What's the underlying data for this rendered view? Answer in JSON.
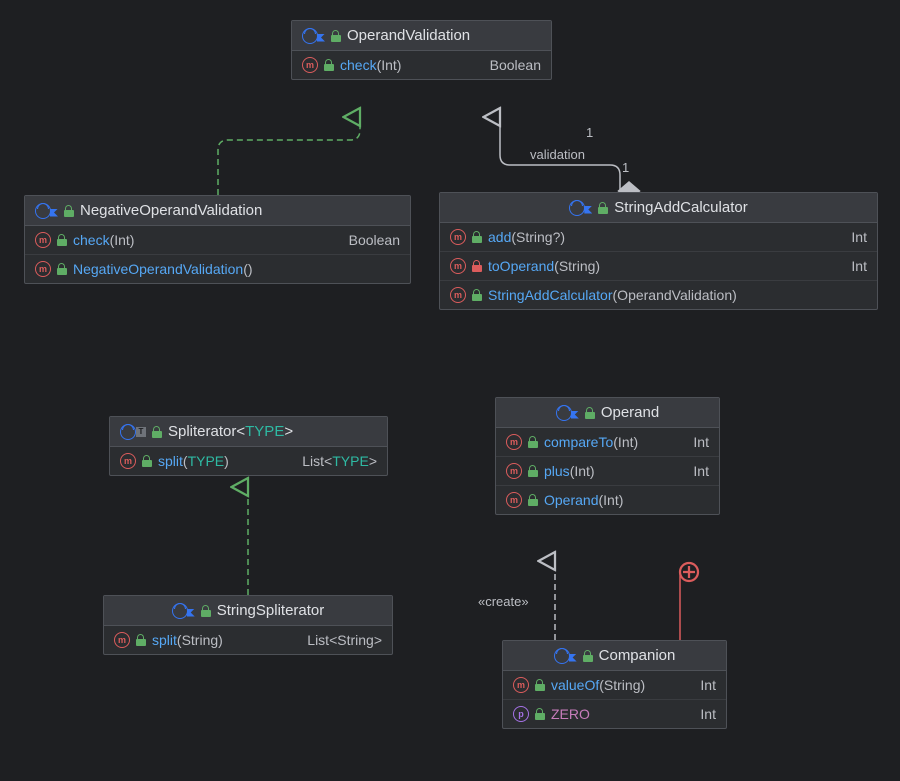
{
  "classes": {
    "operandValidation": {
      "name": "OperandValidation",
      "kind": "interface",
      "generics": null,
      "members": [
        {
          "icon": "method",
          "vis": "public",
          "name": "check",
          "params": "(Int)",
          "ret": "Boolean"
        }
      ]
    },
    "negativeOperandValidation": {
      "name": "NegativeOperandValidation",
      "kind": "class",
      "generics": null,
      "members": [
        {
          "icon": "method",
          "vis": "public",
          "name": "check",
          "params": "(Int)",
          "ret": "Boolean"
        },
        {
          "icon": "method",
          "vis": "public",
          "name": "NegativeOperandValidation",
          "params": "()",
          "ret": ""
        }
      ]
    },
    "stringAddCalculator": {
      "name": "StringAddCalculator",
      "kind": "class",
      "generics": null,
      "members": [
        {
          "icon": "method",
          "vis": "public",
          "name": "add",
          "params": "(String?)",
          "ret": "Int"
        },
        {
          "icon": "method",
          "vis": "private",
          "name": "toOperand",
          "params": "(String)",
          "ret": "Int"
        },
        {
          "icon": "method",
          "vis": "public",
          "name": "StringAddCalculator",
          "params": "(OperandValidation)",
          "ret": ""
        }
      ]
    },
    "spliterator": {
      "name": "Spliterator",
      "kind": "interface",
      "generics": "TYPE",
      "members": [
        {
          "icon": "method",
          "vis": "public",
          "name": "split",
          "params": "(TYPE)",
          "ret": "List<TYPE>",
          "retGeneric": true,
          "paramGeneric": true
        }
      ]
    },
    "stringSpliterator": {
      "name": "StringSpliterator",
      "kind": "class",
      "generics": null,
      "members": [
        {
          "icon": "method",
          "vis": "public",
          "name": "split",
          "params": "(String)",
          "ret": "List<String>"
        }
      ]
    },
    "operand": {
      "name": "Operand",
      "kind": "class",
      "generics": null,
      "members": [
        {
          "icon": "method",
          "vis": "public",
          "name": "compareTo",
          "params": "(Int)",
          "ret": "Int"
        },
        {
          "icon": "method",
          "vis": "public",
          "name": "plus",
          "params": "(Int)",
          "ret": "Int"
        },
        {
          "icon": "method",
          "vis": "public",
          "name": "Operand",
          "params": "(Int)",
          "ret": ""
        }
      ]
    },
    "companion": {
      "name": "Companion",
      "kind": "class",
      "generics": null,
      "members": [
        {
          "icon": "method",
          "vis": "public",
          "name": "valueOf",
          "params": "(String)",
          "ret": "Int"
        },
        {
          "icon": "property",
          "vis": "public",
          "name": "ZERO",
          "params": "",
          "ret": "Int",
          "isProp": true
        }
      ]
    }
  },
  "labels": {
    "validation": "validation",
    "one_top": "1",
    "one_bottom": "1",
    "create": "«create»"
  }
}
